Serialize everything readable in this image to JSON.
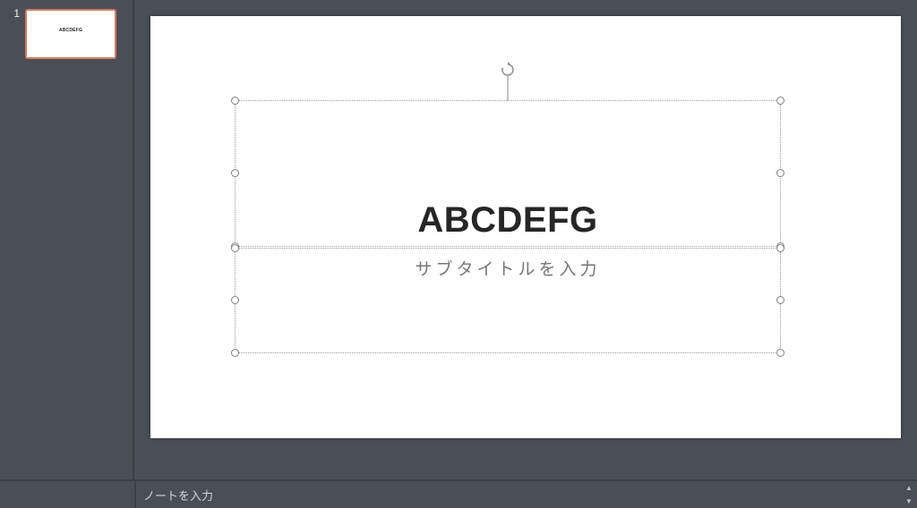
{
  "thumbnails": [
    {
      "index": "1",
      "title": "ABCDEFG"
    }
  ],
  "slide": {
    "title": "ABCDEFG",
    "subtitle": "サブタイトルを入力"
  },
  "notes": {
    "placeholder": "ノートを入力"
  }
}
